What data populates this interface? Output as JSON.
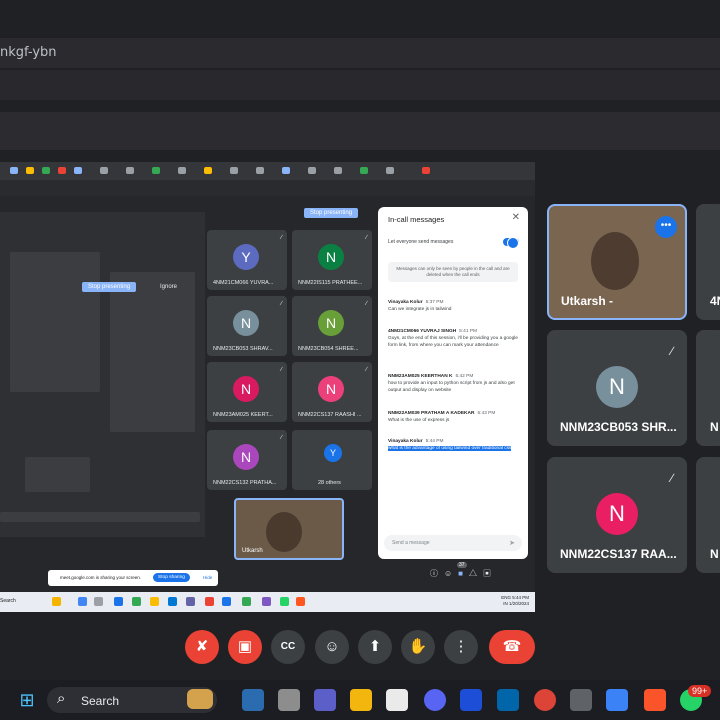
{
  "browser": {
    "url_fragment": "nkgf-ybn"
  },
  "shared_screen": {
    "stop_presenting_label": "Stop presenting",
    "inner_stop_presenting_label": "Stop presenting",
    "ignore_label": "Ignore",
    "tiles": [
      {
        "initial": "Y",
        "name": "4NM21CM066 YUVRA...",
        "color": "#5c6bc0"
      },
      {
        "initial": "N",
        "name": "NNM22IS115 PRATHEE...",
        "color": "#0b8043"
      },
      {
        "initial": "N",
        "name": "NNM23CB053 SHRAV...",
        "color": "#78909c"
      },
      {
        "initial": "N",
        "name": "NNM23CB054 SHREE...",
        "color": "#689f38"
      },
      {
        "initial": "N",
        "name": "NNM23AM025 KEERT...",
        "color": "#d81b60"
      },
      {
        "initial": "N",
        "name": "NNM22CS137 RAASHI ...",
        "color": "#ec407a"
      },
      {
        "initial": "N",
        "name": "NNM22CS132 PRATHA...",
        "color": "#ab47bc"
      },
      {
        "initial": "Y",
        "name": "28 others",
        "color": "#1a73e8"
      }
    ],
    "self_label": "Utkarsh",
    "chat": {
      "title": "In-call messages",
      "toggle_label": "Let everyone send messages",
      "note": "Messages can only be seen by people in the call and are deleted when the call ends",
      "messages": [
        {
          "who": "Vinayaka Kolur",
          "time": "5:37 PM",
          "text": "Can we integrate js in tailwind"
        },
        {
          "who": "4NM21CM066 YUVRAJ SINGH",
          "time": "5:41 PM",
          "text": "Guys, at the end of this session, i'll be providing you a google form link, from where you can mark your attendance"
        },
        {
          "who": "NNM23AM025 KEERTHAN K",
          "time": "5:42 PM",
          "text": "how to provide an input to python script from js and also get output and display on website"
        },
        {
          "who": "NNM22AM039 PRATHAM A KADEKAR",
          "time": "5:43 PM",
          "text": "What is the use of express js"
        },
        {
          "who": "Vinayaka Kolur",
          "time": "5:44 PM",
          "text": "what is the advantage of using tailwind over traditional css"
        }
      ],
      "send_placeholder": "Send a message"
    },
    "share_bar": {
      "text": "meet.google.com is sharing your screen.",
      "stop_label": "Stop sharing",
      "hide_label": "Hide"
    },
    "inner_taskbar": {
      "search": "Search",
      "tray_lang": "ENG",
      "tray_region": "IN",
      "time": "5:44 PM",
      "date": "1/20/2024"
    },
    "participant_count": "37"
  },
  "right_tiles": [
    {
      "initial": "",
      "name": "Utkarsh -",
      "color": ""
    },
    {
      "initial": "N",
      "name": "NNM23CB053 SHR...",
      "color": "#78909c"
    },
    {
      "initial": "N",
      "name": "NNM22CS137 RAA...",
      "color": "#e91e63"
    }
  ],
  "edge_tiles": [
    "4N",
    "N",
    "N"
  ],
  "meet_controls": {
    "mic_icon": "mic-off-icon",
    "camera_icon": "camera-off-icon",
    "cc_label": "CC"
  },
  "taskbar": {
    "search_label": "Search",
    "whatsapp_badge": "99+"
  }
}
